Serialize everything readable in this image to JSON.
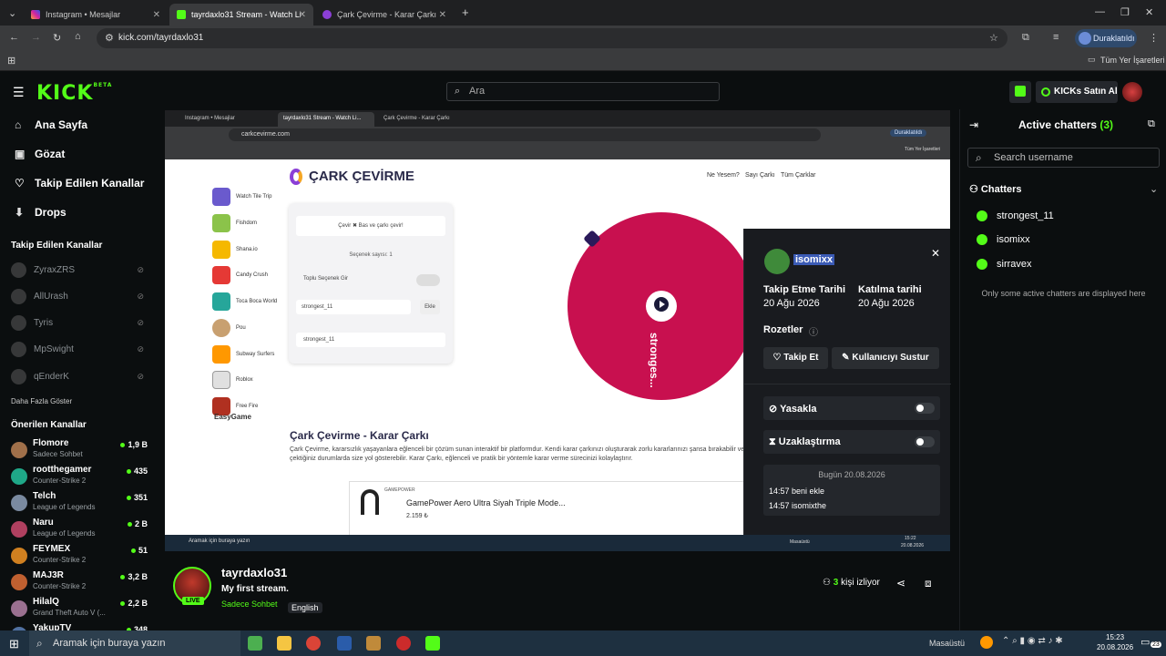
{
  "browser": {
    "tabs": [
      {
        "title": "Instagram • Mesajlar"
      },
      {
        "title": "tayrdaxlo31 Stream - Watch Live"
      },
      {
        "title": "Çark Çevirme - Karar Çarkı"
      }
    ],
    "url": "kick.com/tayrdaxlo31",
    "profile_label": "Duraklatıldı",
    "bookmarks_label": "Tüm Yer İşaretleri"
  },
  "kick": {
    "logo": "KICK",
    "logo_badge": "BETA",
    "search_placeholder": "Ara",
    "kicks_button": "KICKs Satın Al"
  },
  "sidebar": {
    "nav": [
      {
        "label": "Ana Sayfa",
        "icon": "home-icon"
      },
      {
        "label": "Gözat",
        "icon": "browse-icon"
      },
      {
        "label": "Takip Edilen Kanallar",
        "icon": "heart-icon"
      },
      {
        "label": "Drops",
        "icon": "drops-icon"
      }
    ],
    "followed_header": "Takip Edilen Kanallar",
    "followed": [
      "ZyraxZRS",
      "AllUrash",
      "Tyris",
      "MpSwight",
      "qEnderK"
    ],
    "show_more": "Daha Fazla Göster",
    "recommended_header": "Önerilen Kanallar",
    "recommended": [
      {
        "name": "Flomore",
        "category": "Sadece Sohbet",
        "viewers": "1,9 B"
      },
      {
        "name": "rootthegamer",
        "category": "Counter-Strike 2",
        "viewers": "435"
      },
      {
        "name": "Telch",
        "category": "League of Legends",
        "viewers": "351"
      },
      {
        "name": "Naru",
        "category": "League of Legends",
        "viewers": "2 B"
      },
      {
        "name": "FEYMEX",
        "category": "Counter-Strike 2",
        "viewers": "51"
      },
      {
        "name": "MAJ3R",
        "category": "Counter-Strike 2",
        "viewers": "3,2 B"
      },
      {
        "name": "HilalQ",
        "category": "Grand Theft Auto V (...",
        "viewers": "2,2 B"
      },
      {
        "name": "YakupTV",
        "category": "",
        "viewers": "348"
      }
    ]
  },
  "stream": {
    "inner_tabs": [
      "Instagram • Mesajlar",
      "tayrdaxlo31 Stream - Watch Li...",
      "Çark Çevirme - Karar Çarkı"
    ],
    "inner_url": "carkcevirme.com",
    "inner_profile": "Duraklatıldı",
    "inner_bookmarks": "Tüm Yer İşaretleri",
    "site_title": "ÇARK ÇEVİRME",
    "site_links": [
      "Ne Yesem?",
      "Sayı Çarkı",
      "Tüm Çarklar"
    ],
    "apps": [
      "Watch Tile Trip",
      "Fishdom",
      "Shana.io",
      "Candy Crush",
      "Toca Boca World",
      "Pou",
      "Subway Surfers",
      "Roblox",
      "Free Fire"
    ],
    "apps_brand": "EasyGame",
    "panel_spin": "Çevir  ✖ Bas ve çarkı çevir!",
    "panel_count": "Seçenek sayısı: 1",
    "panel_bulk": "Toplu Seçenek Gir",
    "panel_input": "strongest_11",
    "panel_add": "Ekle",
    "panel_item": "strongest_11",
    "wheel_label": "strongest_11",
    "wheel_label_display": "stronges...",
    "article_title": "Çark Çevirme - Karar Çarkı",
    "article_text": "Çark Çevirme, kararsızlık yaşayanlara eğlenceli bir çözüm sunan interaktif bir platformdur. Kendi karar çarkınızı oluşturarak zorlu kararlarınızı şansa bırakabilir ve çektiğiniz durumlarda size yol gösterebilir. Karar Çarkı, eğlenceli ve pratik bir yöntemle karar verme sürecinizi kolaylaştırır.",
    "ad_brand": "GAMEPOWER",
    "ad_title": "GamePower Aero Ultra Siyah Triple Mode...",
    "ad_price": "2.159 ₺",
    "inner_taskbar_search": "Aramak için buraya yazın",
    "inner_taskbar_desktop": "Masaüstü",
    "inner_taskbar_time": "15:22",
    "inner_taskbar_date": "20.08.2026"
  },
  "usercard": {
    "username": "isomixx",
    "follow_date_label": "Takip Etme Tarihi",
    "follow_date": "20 Ağu 2026",
    "join_date_label": "Katılma tarihi",
    "join_date": "20 Ağu 2026",
    "badges_label": "Rozetler",
    "follow_button": "Takip Et",
    "mute_button": "Kullanıcıyı Sustur",
    "ban_label": "Yasakla",
    "timeout_label": "Uzaklaştırma",
    "log_date": "Bugün 20.08.2026",
    "log": [
      "14:57 beni ekle",
      "14:57 isomixthe"
    ]
  },
  "chatpanel": {
    "title": "Active chatters",
    "count": "(3)",
    "search_placeholder": "Search username",
    "section": "Chatters",
    "chatters": [
      "strongest_11",
      "isomixx",
      "sirravex"
    ],
    "note": "Only some active chatters are displayed here"
  },
  "channel": {
    "name": "tayrdaxlo31",
    "title": "My first stream.",
    "category": "Sadece Sohbet",
    "language": "English",
    "live_badge": "LIVE",
    "viewers": "3",
    "viewers_label": "kişi izliyor"
  },
  "taskbar": {
    "search_placeholder": "Aramak için buraya yazın",
    "desktop_label": "Masaüstü",
    "time": "15:23",
    "date": "20.08.2026",
    "notification_count": "23"
  },
  "colors": {
    "kick_green": "#53fc18",
    "wheel": "#c8104f",
    "chrome_dark": "#1f2022",
    "chrome_bar": "#3a3b3d"
  }
}
